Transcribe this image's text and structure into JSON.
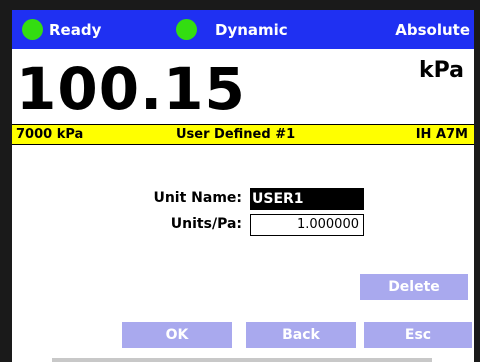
{
  "status": {
    "ready_label": "Ready",
    "mode_label": "Dynamic",
    "reference_label": "Absolute"
  },
  "reading": {
    "value": "100.15",
    "unit": "kPa"
  },
  "info": {
    "range": "7000 kPa",
    "unit_name": "User Defined #1",
    "sensor": "IH A7M"
  },
  "form": {
    "unit_name_label": "Unit Name:",
    "unit_name_value": "USER1",
    "units_pa_label": "Units/Pa:",
    "units_pa_value": "1.000000"
  },
  "buttons": {
    "delete": "Delete",
    "ok": "OK",
    "back": "Back",
    "esc": "Esc"
  },
  "colors": {
    "statusbar": "#1f30f2",
    "led": "#33dd11",
    "infobar": "#ffff00",
    "button": "#a9a9ee"
  }
}
